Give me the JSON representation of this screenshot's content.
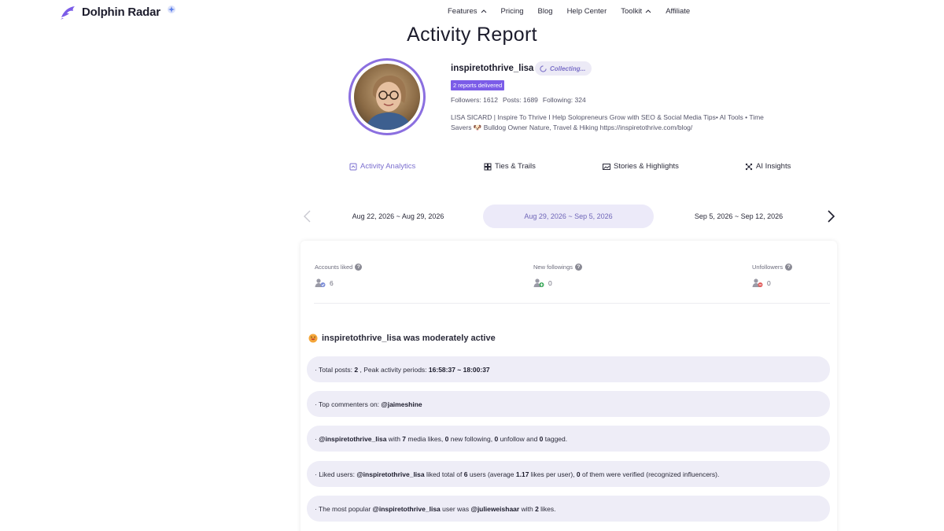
{
  "header": {
    "brand": "Dolphin Radar",
    "nav": [
      {
        "label": "Features",
        "chevron": true
      },
      {
        "label": "Pricing",
        "chevron": false
      },
      {
        "label": "Blog",
        "chevron": false
      },
      {
        "label": "Help Center",
        "chevron": false
      },
      {
        "label": "Toolkit",
        "chevron": true
      },
      {
        "label": "Affiliate",
        "chevron": false
      }
    ]
  },
  "page_title": "Activity Report",
  "profile": {
    "username": "inspiretothrive_lisa",
    "status": "Collecting...",
    "reports_badge": "2 reports delivered",
    "followers": "Followers: 1612",
    "posts": "Posts: 1689",
    "following": "Following: 324",
    "bio_line1": "LISA SICARD | Inspire To Thrive I Help Solopreneurs Grow with SEO & Social Media Tips• AI Tools • Time",
    "bio_line2": "Savers 🐶 Bulldog Owner Nature, Travel & Hiking https://inspiretothrive.com/blog/"
  },
  "tabs": [
    {
      "label": "Activity Analytics",
      "icon": "shield-chart-icon",
      "active": true
    },
    {
      "label": "Ties & Trails",
      "icon": "grid-icon",
      "active": false
    },
    {
      "label": "Stories & Highlights",
      "icon": "image-icon",
      "active": false
    },
    {
      "label": "AI Insights",
      "icon": "sparkle-network-icon",
      "active": false
    }
  ],
  "weeks": [
    {
      "label": "Aug 22, 2026 ~ Aug 29, 2026",
      "active": false
    },
    {
      "label": "Aug 29, 2026 ~ Sep 5, 2026",
      "active": true
    },
    {
      "label": "Sep 5, 2026 ~ Sep 12, 2026",
      "active": false
    }
  ],
  "metrics": [
    {
      "label": "Accounts liked",
      "value": "6",
      "icon": "user-heart-icon"
    },
    {
      "label": "New followings",
      "value": "0",
      "icon": "user-add-icon"
    },
    {
      "label": "Unfollowers",
      "value": "0",
      "icon": "user-remove-icon"
    }
  ],
  "activity": {
    "headline": "inspiretothrive_lisa was moderately active",
    "rows": [
      {
        "parts": [
          [
            "· Total posts: ",
            false
          ],
          [
            "2",
            true
          ],
          [
            " , Peak activity periods: ",
            false
          ],
          [
            "16:58:37 ~ 18:00:37",
            true
          ]
        ]
      },
      {
        "parts": [
          [
            "· Top commenters on: ",
            false
          ],
          [
            "@jaimeshine",
            true
          ]
        ]
      },
      {
        "parts": [
          [
            "· ",
            false
          ],
          [
            "@inspiretothrive_lisa",
            true
          ],
          [
            " with ",
            false
          ],
          [
            "7",
            true
          ],
          [
            " media likes, ",
            false
          ],
          [
            "0",
            true
          ],
          [
            " new following, ",
            false
          ],
          [
            "0",
            true
          ],
          [
            " unfollow and ",
            false
          ],
          [
            "0",
            true
          ],
          [
            " tagged.",
            false
          ]
        ]
      },
      {
        "parts": [
          [
            "· Liked users: ",
            false
          ],
          [
            "@inspiretothrive_lisa",
            true
          ],
          [
            " liked total of ",
            false
          ],
          [
            "6",
            true
          ],
          [
            " users (average ",
            false
          ],
          [
            "1.17",
            true
          ],
          [
            " likes per user), ",
            false
          ],
          [
            "0",
            true
          ],
          [
            " of them were verified (recognized influencers).",
            false
          ]
        ]
      },
      {
        "parts": [
          [
            "· The most popular ",
            false
          ],
          [
            "@inspiretothrive_lisa",
            true
          ],
          [
            " user was ",
            false
          ],
          [
            "@julieweishaar",
            true
          ],
          [
            " with ",
            false
          ],
          [
            "2",
            true
          ],
          [
            " likes.",
            false
          ]
        ]
      }
    ]
  },
  "colors": {
    "accent": "#7b5ce8",
    "avatar_ring": "#8b6fe0",
    "row_bg": "#eeedf7",
    "week_active_bg": "#eceaf9"
  }
}
